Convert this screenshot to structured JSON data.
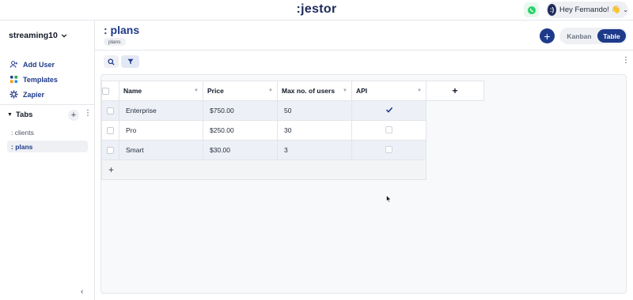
{
  "app": {
    "logo": ":jestor"
  },
  "user": {
    "avatar_text": ":)",
    "greeting": "Hey Fernando! 👋"
  },
  "sidebar": {
    "workspace": "streaming10",
    "links": [
      {
        "label": "Add User",
        "icon": "add-user-icon"
      },
      {
        "label": "Templates",
        "icon": "templates-icon"
      },
      {
        "label": "Zapier",
        "icon": "zapier-icon"
      }
    ],
    "tabs_header": "Tabs",
    "tabs": [
      {
        "label": ": clients",
        "active": false
      },
      {
        "label": ": plans",
        "active": true
      }
    ]
  },
  "page": {
    "title": ": plans",
    "tag": "plans"
  },
  "view_toggle": {
    "kanban": "Kanban",
    "table": "Table",
    "selected": "Table"
  },
  "table": {
    "columns": [
      "Name",
      "Price",
      "Max no. of users",
      "API"
    ],
    "add_column_label": "+",
    "rows": [
      {
        "name": "Enterprise",
        "price": "$750.00",
        "max_users": "50",
        "api": true
      },
      {
        "name": "Pro",
        "price": "$250.00",
        "max_users": "30",
        "api": false
      },
      {
        "name": "Smart",
        "price": "$30.00",
        "max_users": "3",
        "api": false
      }
    ],
    "add_row_label": "+"
  },
  "colors": {
    "accent": "#1e3a8a",
    "row_highlight": "#eef0f7",
    "whatsapp": "#25d366"
  }
}
